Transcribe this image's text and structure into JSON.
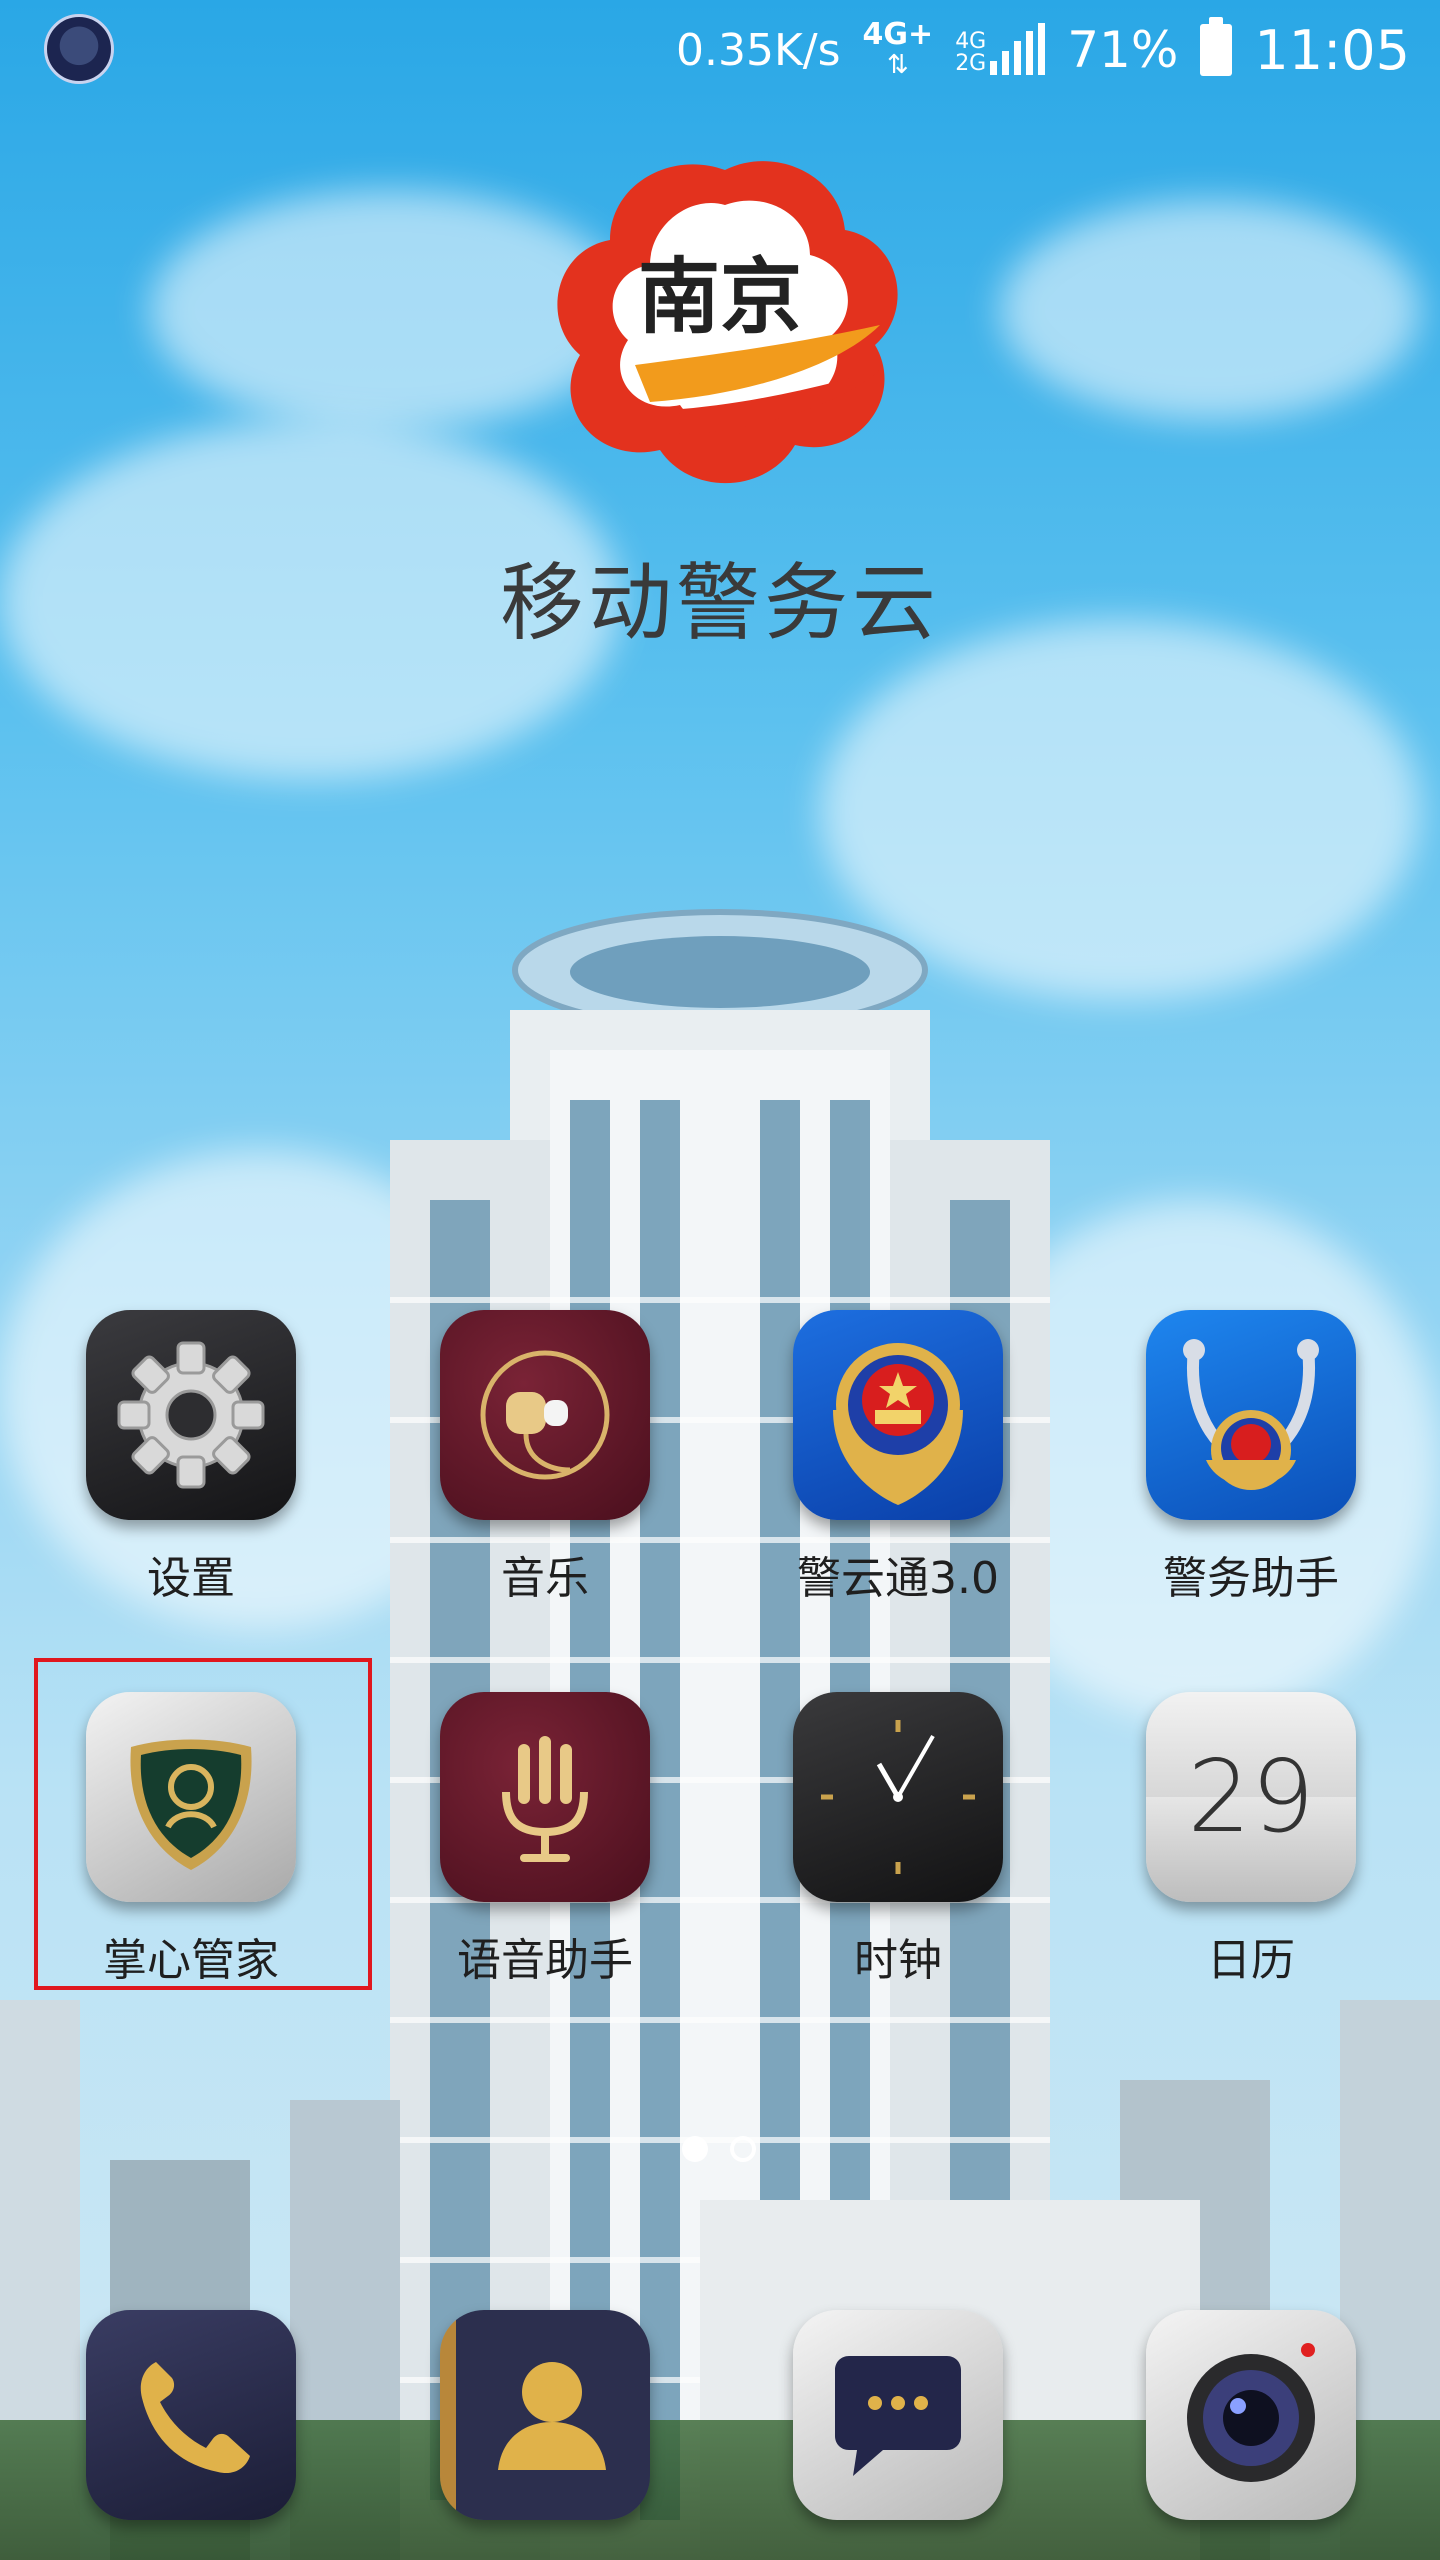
{
  "status_bar": {
    "network_speed": "0.35K/s",
    "network_type": "4G+",
    "sim_network": "4G",
    "sim_network_2": "2G",
    "battery_percent": "71%",
    "time": "11:05"
  },
  "wallpaper": {
    "logo_text": "南京",
    "title": "移动警务云"
  },
  "apps": [
    {
      "label": "设置",
      "icon": "settings-gear-icon"
    },
    {
      "label": "音乐",
      "icon": "music-earphone-icon"
    },
    {
      "label": "警云通3.0",
      "icon": "police-emblem-icon"
    },
    {
      "label": "警务助手",
      "icon": "police-assistant-icon"
    },
    {
      "label": "掌心管家",
      "icon": "phone-manager-shield-icon"
    },
    {
      "label": "语音助手",
      "icon": "voice-assistant-icon"
    },
    {
      "label": "时钟",
      "icon": "clock-icon"
    },
    {
      "label": "日历",
      "icon": "calendar-icon",
      "day": "29"
    }
  ],
  "dock": [
    {
      "icon": "phone-icon"
    },
    {
      "icon": "contacts-icon"
    },
    {
      "icon": "messages-icon"
    },
    {
      "icon": "camera-icon"
    }
  ],
  "page_indicator": {
    "pages": 2,
    "current": 1
  }
}
